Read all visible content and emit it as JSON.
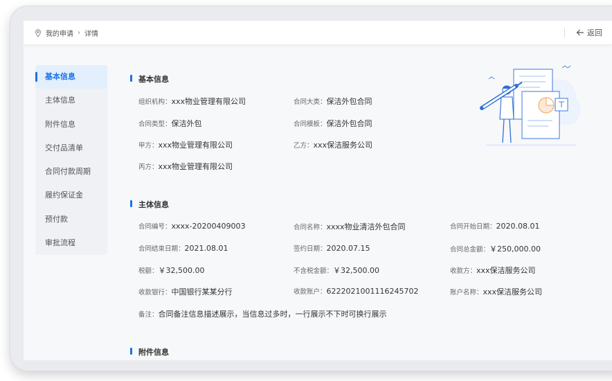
{
  "breadcrumb": {
    "home": "我的申请",
    "current": "详情"
  },
  "back_label": "返回",
  "sidebar": {
    "items": [
      {
        "label": "基本信息"
      },
      {
        "label": "主体信息"
      },
      {
        "label": "附件信息"
      },
      {
        "label": "交付品清单"
      },
      {
        "label": "合同付款周期"
      },
      {
        "label": "履约保证金"
      },
      {
        "label": "预付款"
      },
      {
        "label": "审批流程"
      }
    ]
  },
  "basic": {
    "title": "基本信息",
    "fields": [
      {
        "label": "组织机构：",
        "value": "xxx物业管理有限公司"
      },
      {
        "label": "合同大类：",
        "value": "保洁外包合同"
      },
      {
        "label": "合同类型：",
        "value": "保洁外包"
      },
      {
        "label": "合同模板：",
        "value": "保洁外包合同"
      },
      {
        "label": "甲方：",
        "value": "xxx物业管理有限公司"
      },
      {
        "label": "乙方：",
        "value": "xxx保洁服务公司"
      },
      {
        "label": "丙方：",
        "value": "xxx物业管理有限公司"
      }
    ]
  },
  "subject": {
    "title": "主体信息",
    "fields": [
      {
        "label": "合同编号：",
        "value": "xxxx-20200409003"
      },
      {
        "label": "合同名称：",
        "value": "xxxx物业清洁外包合同"
      },
      {
        "label": "合同开始日期：",
        "value": "2020.08.01"
      },
      {
        "label": "合同结束日期：",
        "value": "2021.08.01"
      },
      {
        "label": "签约日期：",
        "value": "2020.07.15"
      },
      {
        "label": "合同总金额：",
        "value": "￥250,000.00"
      },
      {
        "label": "税额：",
        "value": "￥32,500.00"
      },
      {
        "label": "不含税金额：",
        "value": "￥32,500.00"
      },
      {
        "label": "收款方：",
        "value": "xxx保洁服务公司"
      },
      {
        "label": "收款银行：",
        "value": "中国银行某某分行"
      },
      {
        "label": "收款账户：",
        "value": "6222021001116245702"
      },
      {
        "label": "账户名称：",
        "value": "xxx保洁服务公司"
      },
      {
        "label": "备注：",
        "value": "合同备注信息描述展示，当信息过多时，一行展示不下时可换行展示"
      }
    ]
  },
  "attachments": {
    "title": "附件信息"
  },
  "colors": {
    "accent": "#1a73e8",
    "sidebar_bg": "#eff1f4",
    "active_bg": "#e3effc"
  }
}
